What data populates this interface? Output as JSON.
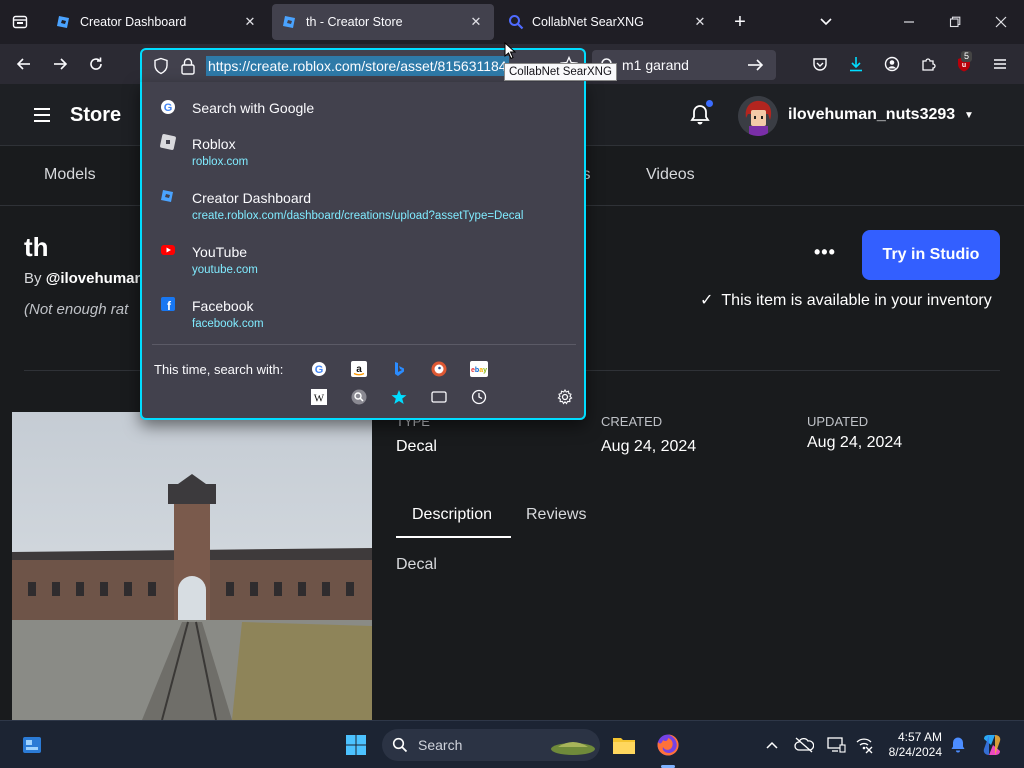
{
  "browser": {
    "tabs": [
      {
        "title": "Creator Dashboard",
        "active": false
      },
      {
        "title": "th - Creator Store",
        "active": true
      },
      {
        "title": "CollabNet SearXNG",
        "active": false
      }
    ],
    "url": "https://create.roblox.com/store/asset/815631184",
    "search_value": "m1 garand",
    "tooltip": "CollabNet SearXNG",
    "extension_badge": "5",
    "accent": "#00ddff"
  },
  "dropdown": {
    "items": [
      {
        "title": "Search with Google",
        "url": "",
        "icon": "google-icon"
      },
      {
        "title": "Roblox",
        "url": "roblox.com",
        "icon": "roblox-icon"
      },
      {
        "title": "Creator Dashboard",
        "url": "create.roblox.com/dashboard/creations/upload?assetType=Decal",
        "icon": "creator-dashboard-icon"
      },
      {
        "title": "YouTube",
        "url": "youtube.com",
        "icon": "youtube-icon"
      },
      {
        "title": "Facebook",
        "url": "facebook.com",
        "icon": "facebook-icon"
      }
    ],
    "this_time_label": "This time, search with:",
    "engines": [
      "google",
      "amazon",
      "bing",
      "duckduckgo",
      "ebay",
      "wikipedia",
      "searxng",
      "bookmarks",
      "tabs",
      "history"
    ]
  },
  "store": {
    "header": {
      "title": "Store",
      "username": "ilovehuman_nuts3293"
    },
    "categories": [
      "Models",
      "ts",
      "Videos"
    ],
    "asset": {
      "title": "th",
      "by_prefix": "By ",
      "creator": "@ilovehuman",
      "rating": "(Not enough rat",
      "try_button": "Try in Studio",
      "inventory_note": "This item is available in your inventory"
    },
    "meta": {
      "type_label": "TYPE",
      "type_value": "Decal",
      "created_label": "CREATED",
      "created_value": "Aug 24, 2024",
      "updated_label": "UPDATED",
      "updated_value": "Aug 24, 2024"
    },
    "detail_tabs": [
      "Description",
      "Reviews"
    ],
    "description": "Decal",
    "accent": "#335fff"
  },
  "taskbar": {
    "search_placeholder": "Search",
    "time": "4:57 AM",
    "date": "8/24/2024"
  }
}
